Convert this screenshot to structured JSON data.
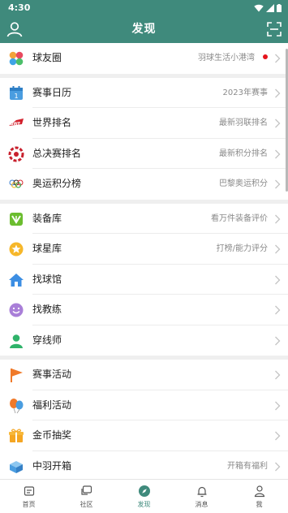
{
  "status_bar": {
    "time": "4:30"
  },
  "header": {
    "title": "发现"
  },
  "groups": [
    [
      {
        "label": "球友圈",
        "sub": "羽球生活小港湾",
        "icon": "petal-icon",
        "dot": true
      }
    ],
    [
      {
        "label": "赛事日历",
        "sub": "2023年赛事",
        "icon": "calendar-icon"
      },
      {
        "label": "世界排名",
        "sub": "最新羽联排名",
        "icon": "bwf-icon"
      },
      {
        "label": "总决赛排名",
        "sub": "最新积分排名",
        "icon": "finals-icon"
      },
      {
        "label": "奥运积分榜",
        "sub": "巴黎奥运积分",
        "icon": "olympic-rings-icon"
      }
    ],
    [
      {
        "label": "装备库",
        "sub": "看万件装备评价",
        "icon": "equipment-icon"
      },
      {
        "label": "球星库",
        "sub": "打榜/能力评分",
        "icon": "star-icon"
      },
      {
        "label": "找球馆",
        "sub": "",
        "icon": "home-icon"
      },
      {
        "label": "找教练",
        "sub": "",
        "icon": "smile-icon"
      },
      {
        "label": "穿线师",
        "sub": "",
        "icon": "person-icon"
      }
    ],
    [
      {
        "label": "赛事活动",
        "sub": "",
        "icon": "flag-icon"
      },
      {
        "label": "福利活动",
        "sub": "",
        "icon": "balloon-icon"
      },
      {
        "label": "金币抽奖",
        "sub": "",
        "icon": "gift-icon"
      },
      {
        "label": "中羽开箱",
        "sub": "开箱有福利",
        "icon": "box-icon"
      }
    ]
  ],
  "tabs": [
    {
      "label": "首页",
      "icon": "home-tab-icon"
    },
    {
      "label": "社区",
      "icon": "community-icon"
    },
    {
      "label": "发现",
      "icon": "compass-icon",
      "active": true
    },
    {
      "label": "消息",
      "icon": "bell-icon"
    },
    {
      "label": "我",
      "icon": "profile-icon"
    }
  ],
  "colors": {
    "header": "#3f8a7c",
    "accent": "#3f8a7c",
    "dot": "#e5141c"
  }
}
